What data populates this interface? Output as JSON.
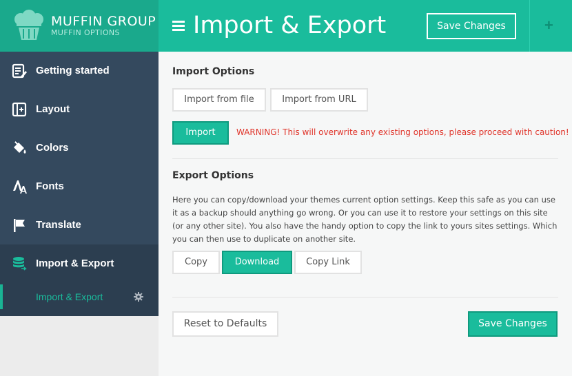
{
  "brand": {
    "name": "MUFFIN GROUP",
    "subtitle": "MUFFIN OPTIONS",
    "logo_icon": "muffin-icon"
  },
  "sidebar": {
    "items": [
      {
        "label": "Getting started",
        "icon": "edit-list-icon"
      },
      {
        "label": "Layout",
        "icon": "layout-icon"
      },
      {
        "label": "Colors",
        "icon": "paint-bucket-icon"
      },
      {
        "label": "Fonts",
        "icon": "font-icon"
      },
      {
        "label": "Translate",
        "icon": "flag-icon"
      },
      {
        "label": "Import & Export",
        "icon": "database-icon",
        "active": true
      }
    ],
    "subitem": {
      "label": "Import & Export",
      "icon": "gear-icon"
    }
  },
  "header": {
    "title": "Import & Export",
    "save_label": "Save Changes",
    "menu_icon": "hamburger-icon",
    "plus_icon": "plus-icon"
  },
  "import": {
    "title": "Import Options",
    "tab_file": "Import from file",
    "tab_url": "Import from URL",
    "import_label": "Import",
    "warning": "WARNING! This will overwrite any existing options, please proceed with caution!"
  },
  "export": {
    "title": "Export Options",
    "description": "Here you can copy/download your themes current option settings. Keep this safe as you can use it as a backup should anything go wrong. Or you can use it to restore your settings on this site (or any other site). You also have the handy option to copy the link to yours sites settings. Which you can then use to duplicate on another site.",
    "copy_label": "Copy",
    "download_label": "Download",
    "copy_link_label": "Copy Link"
  },
  "footer": {
    "reset_label": "Reset to Defaults",
    "save_label": "Save Changes"
  },
  "colors": {
    "accent": "#1abc9c",
    "sidebar": "#34495e",
    "warning": "#e0352b"
  }
}
